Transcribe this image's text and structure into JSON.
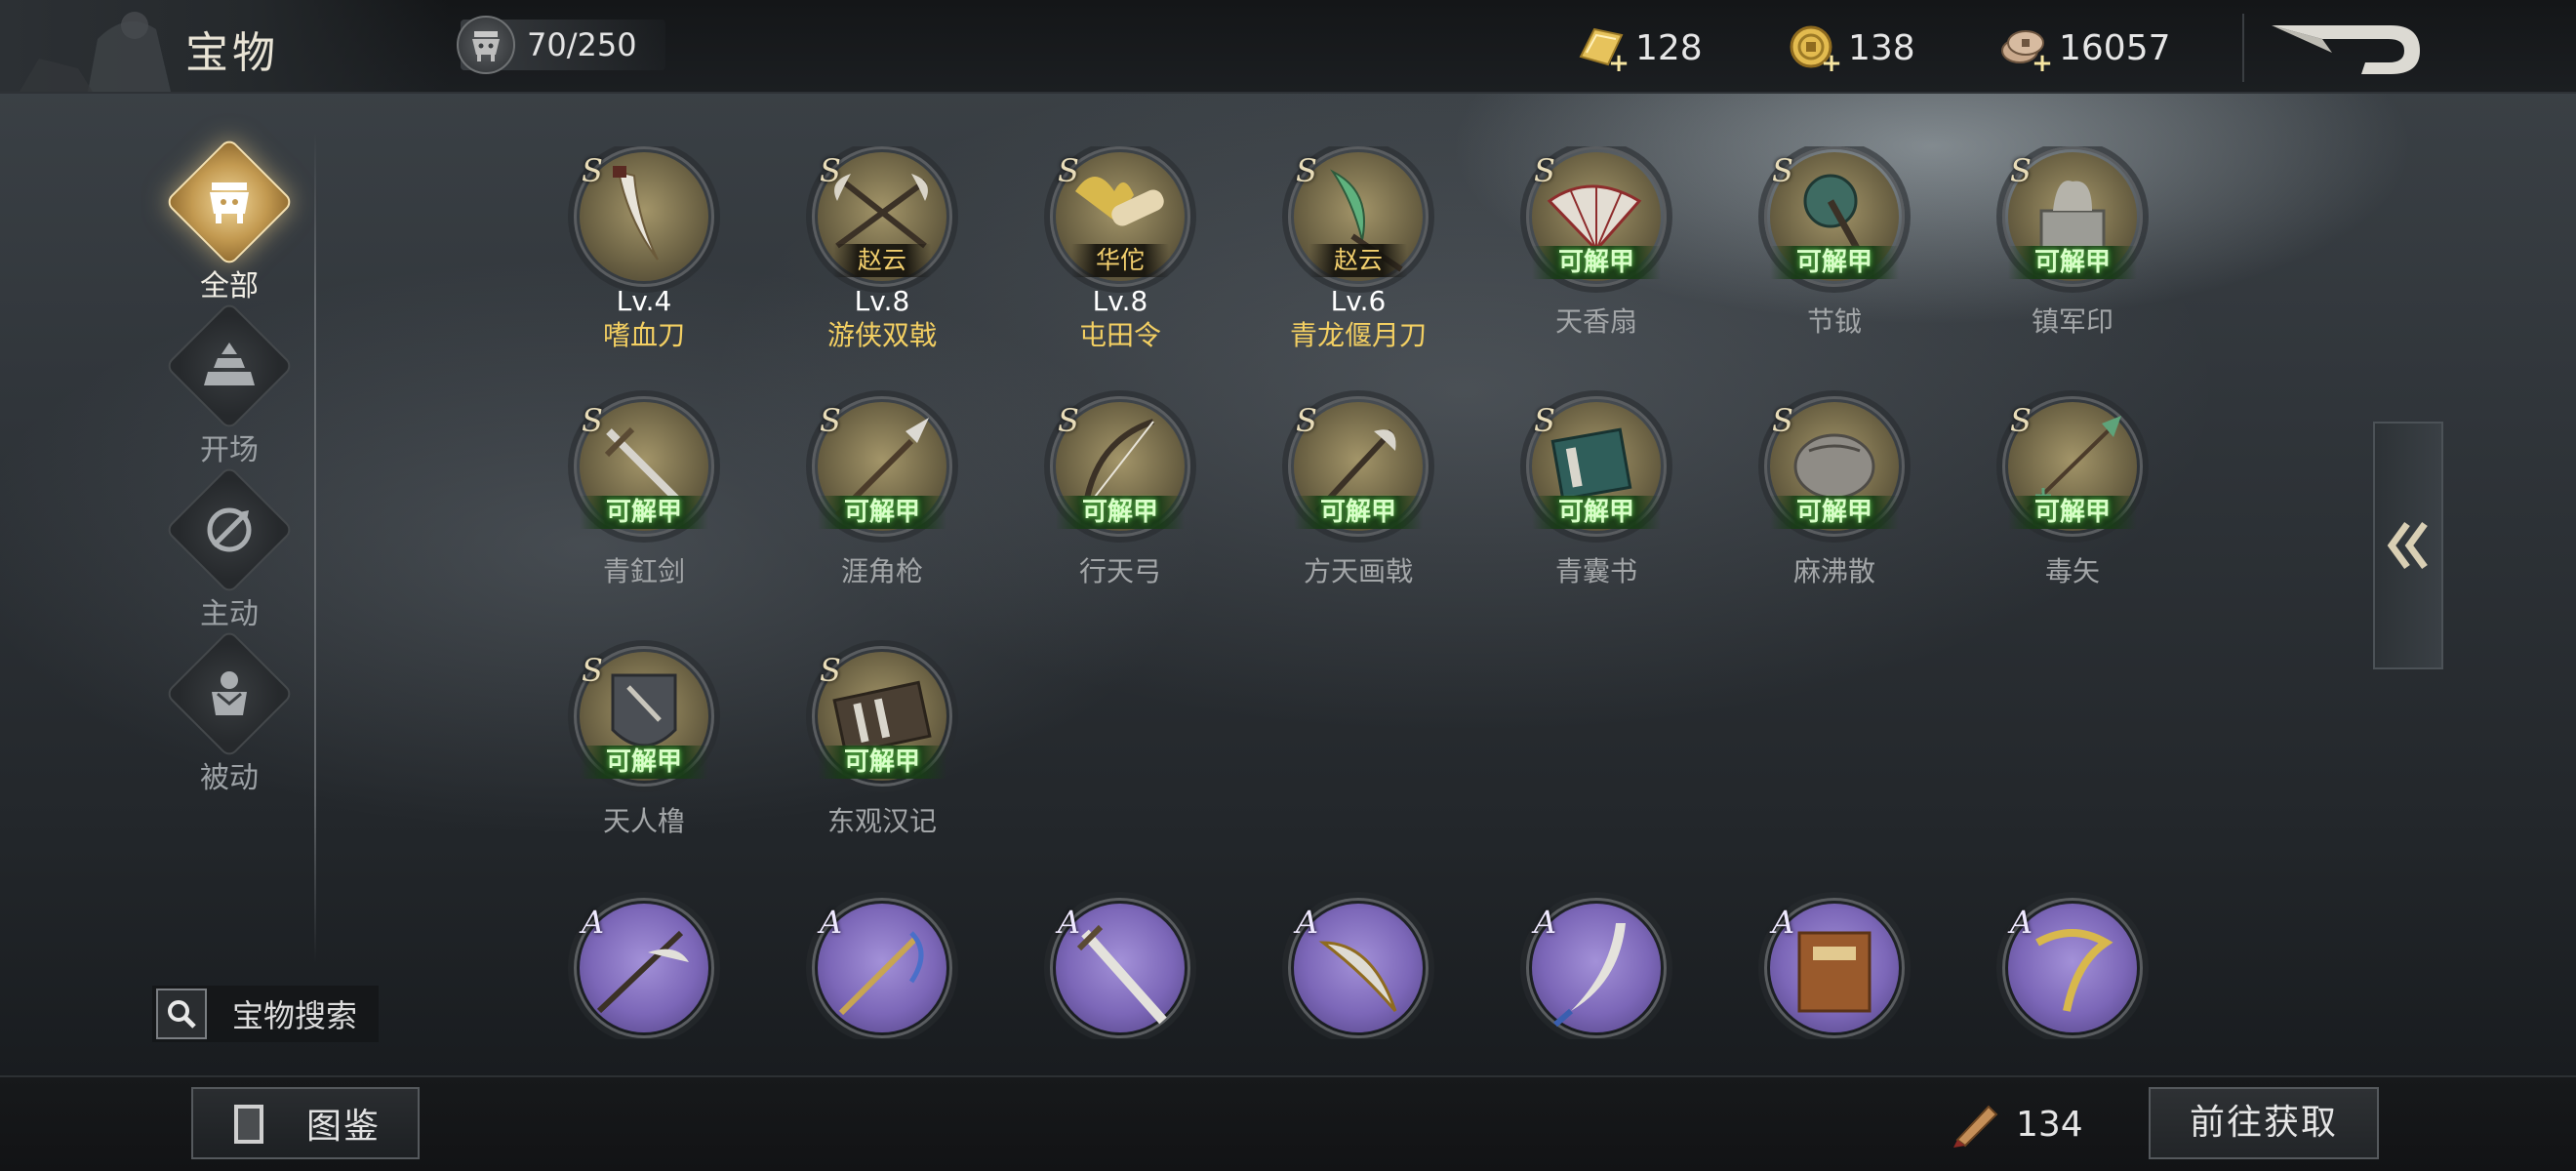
{
  "header": {
    "title": "宝物",
    "capacity": "70/250",
    "currencies": [
      {
        "icon": "gold-ingot-icon",
        "value": "128"
      },
      {
        "icon": "gold-coin-icon",
        "value": "138"
      },
      {
        "icon": "copper-coin-icon",
        "value": "16057"
      }
    ]
  },
  "nav": {
    "items": [
      {
        "label": "全部",
        "icon": "treasure-all-icon",
        "active": true
      },
      {
        "label": "开场",
        "icon": "opening-icon",
        "active": false
      },
      {
        "label": "主动",
        "icon": "active-skill-icon",
        "active": false
      },
      {
        "label": "被动",
        "icon": "passive-skill-icon",
        "active": false
      }
    ],
    "search_label": "宝物搜索"
  },
  "treasures": [
    {
      "grade": "S",
      "name": "嗜血刀",
      "level": "Lv.4",
      "hero": "",
      "tag": "",
      "owned": true
    },
    {
      "grade": "S",
      "name": "游侠双戟",
      "level": "Lv.8",
      "hero": "赵云",
      "tag": "",
      "owned": true
    },
    {
      "grade": "S",
      "name": "屯田令",
      "level": "Lv.8",
      "hero": "华佗",
      "tag": "",
      "owned": true
    },
    {
      "grade": "S",
      "name": "青龙偃月刀",
      "level": "Lv.6",
      "hero": "赵云",
      "tag": "",
      "owned": true
    },
    {
      "grade": "S",
      "name": "天香扇",
      "level": "",
      "hero": "",
      "tag": "可解甲",
      "owned": false
    },
    {
      "grade": "S",
      "name": "节钺",
      "level": "",
      "hero": "",
      "tag": "可解甲",
      "owned": false
    },
    {
      "grade": "S",
      "name": "镇军印",
      "level": "",
      "hero": "",
      "tag": "可解甲",
      "owned": false
    },
    {
      "grade": "S",
      "name": "青釭剑",
      "level": "",
      "hero": "",
      "tag": "可解甲",
      "owned": false
    },
    {
      "grade": "S",
      "name": "涯角枪",
      "level": "",
      "hero": "",
      "tag": "可解甲",
      "owned": false
    },
    {
      "grade": "S",
      "name": "行天弓",
      "level": "",
      "hero": "",
      "tag": "可解甲",
      "owned": false
    },
    {
      "grade": "S",
      "name": "方天画戟",
      "level": "",
      "hero": "",
      "tag": "可解甲",
      "owned": false
    },
    {
      "grade": "S",
      "name": "青囊书",
      "level": "",
      "hero": "",
      "tag": "可解甲",
      "owned": false
    },
    {
      "grade": "S",
      "name": "麻沸散",
      "level": "",
      "hero": "",
      "tag": "可解甲",
      "owned": false
    },
    {
      "grade": "S",
      "name": "毒矢",
      "level": "",
      "hero": "",
      "tag": "可解甲",
      "owned": false
    },
    {
      "grade": "S",
      "name": "天人橹",
      "level": "",
      "hero": "",
      "tag": "可解甲",
      "owned": false
    },
    {
      "grade": "S",
      "name": "东观汉记",
      "level": "",
      "hero": "",
      "tag": "可解甲",
      "owned": false
    },
    {
      "grade": "A",
      "name": "",
      "level": "",
      "hero": "",
      "tag": "",
      "owned": false
    },
    {
      "grade": "A",
      "name": "",
      "level": "",
      "hero": "",
      "tag": "",
      "owned": false
    },
    {
      "grade": "A",
      "name": "",
      "level": "",
      "hero": "",
      "tag": "",
      "owned": false
    },
    {
      "grade": "A",
      "name": "",
      "level": "",
      "hero": "",
      "tag": "",
      "owned": false
    },
    {
      "grade": "A",
      "name": "",
      "level": "",
      "hero": "",
      "tag": "",
      "owned": false
    },
    {
      "grade": "A",
      "name": "",
      "level": "",
      "hero": "",
      "tag": "",
      "owned": false
    },
    {
      "grade": "A",
      "name": "",
      "level": "",
      "hero": "",
      "tag": "",
      "owned": false
    }
  ],
  "footer": {
    "codex_label": "图鉴",
    "token_icon": "brush-token-icon",
    "token_value": "134",
    "goto_label": "前往获取"
  }
}
